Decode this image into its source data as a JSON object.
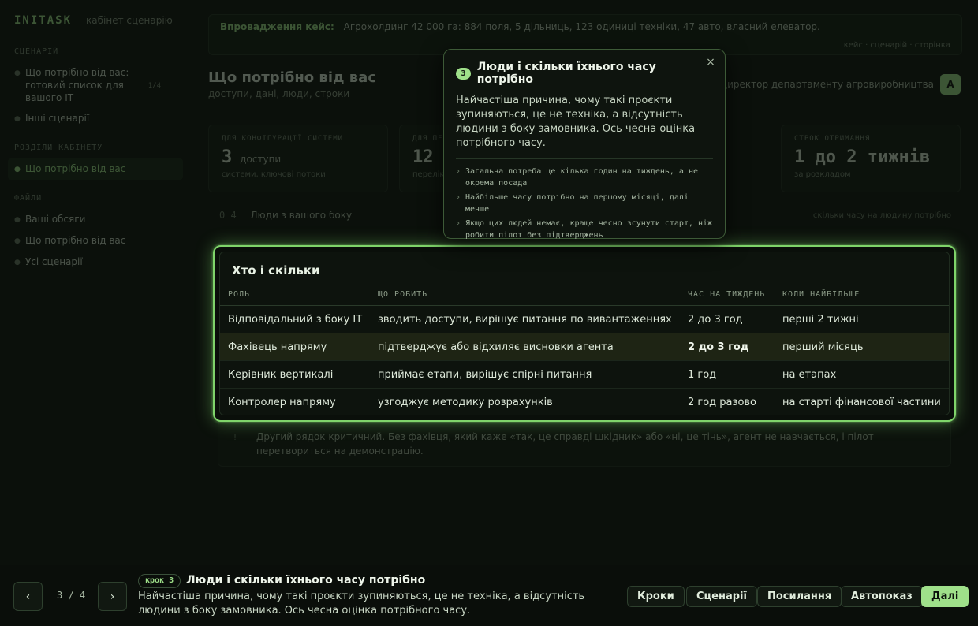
{
  "sidebar": {
    "brand": "INITASK",
    "brand_sub": "кабінет сценарію",
    "groups": [
      {
        "label": "СЦЕНАРІЙ",
        "items": [
          "Що потрібно від вас: готовий список для вашого IT",
          "Інші сценарії"
        ]
      },
      {
        "label": "РОЗДІЛИ КАБІНЕТУ",
        "items": [
          "Що потрібно від вас"
        ]
      },
      {
        "label": "ФАЙЛИ",
        "items": [
          "Ваші обсяги",
          "Що потрібно від вас",
          "Усі сценарії"
        ]
      }
    ],
    "badge": "1/4"
  },
  "banner": {
    "title": "Впровадження кейс:",
    "text": "Агрохолдинг 42 000 га: 884 поля, 5 дільниць, 123 одиниці техніки, 47 авто, власний елеватор.",
    "links": "кейс · сценарій · сторінка"
  },
  "page": {
    "title": "Що потрібно від вас",
    "subtitle": "доступи, дані, люди, строки",
    "owner": "Директор департаменту агровиробництва",
    "owner_initial": "А"
  },
  "stats": [
    {
      "label": "ДЛЯ КОНФІГУРАЦІЇ СИСТЕМИ",
      "value": "3",
      "unit": "доступи",
      "note": "системи, ключові потоки"
    },
    {
      "label": "ДЛЯ ПЕРЕВІРКИ",
      "value": "12",
      "unit": "",
      "note": "перелік даних"
    },
    {
      "label": "СТРОК ОТРИМАННЯ",
      "value": "1 до 2 тижнів",
      "unit": "",
      "note": "за розкладом"
    }
  ],
  "section": {
    "num": "0 4",
    "title": "Люди з вашого боку",
    "right": "скільки часу на людину потрібно"
  },
  "table": {
    "title": "Хто і скільки",
    "headers": [
      "РОЛЬ",
      "ЩО РОБИТЬ",
      "ЧАС НА ТИЖДЕНЬ",
      "КОЛИ НАЙБІЛЬШЕ"
    ],
    "rows": [
      [
        "Відповідальний з боку IT",
        "зводить доступи, вирішує питання по вивантаженнях",
        "2 до 3 год",
        "перші 2 тижні"
      ],
      [
        "Фахівець напряму",
        "підтверджує або відхиляє висновки агента",
        "2 до 3 год",
        "перший місяць"
      ],
      [
        "Керівник вертикалі",
        "приймає етапи, вирішує спірні питання",
        "1 год",
        "на етапах"
      ],
      [
        "Контролер напряму",
        "узгоджує методику розрахунків",
        "2 год разово",
        "на старті фінансової частини"
      ]
    ]
  },
  "note": {
    "num": "!",
    "text": "Другий рядок критичний. Без фахівця, який каже «так, це справді шкідник» або «ні, це тінь», агент не навчається, і пілот перетвориться на демонстрацію."
  },
  "popover": {
    "step": "3",
    "title": "Люди і скільки їхнього часу потрібно",
    "body": "Найчастіша причина, чому такі проєкти зупиняються, це не техніка, а відсутність людини з боку замовника. Ось чесна оцінка потрібного часу.",
    "bullets": [
      "Загальна потреба це кілька годин на тиждень, а не окрема посада",
      "Найбільше часу потрібно на першому місяці, далі менше",
      "Якщо цих людей немає, краще чесно зсунути старт, ніж робити пілот без підтверджень"
    ],
    "close": "×"
  },
  "tour": {
    "prev": "‹",
    "next": "›",
    "counter": "3 / 4",
    "step_label": "крок 3",
    "title": "Люди і скільки їхнього часу потрібно",
    "desc": "Найчастіша причина, чому такі проєкти зупиняються, це не техніка, а відсутність людини з боку замовника. Ось чесна оцінка потрібного часу.",
    "buttons": [
      "Кроки",
      "Сценарії",
      "Посилання",
      "Автопоказ"
    ],
    "primary": "Далі"
  }
}
